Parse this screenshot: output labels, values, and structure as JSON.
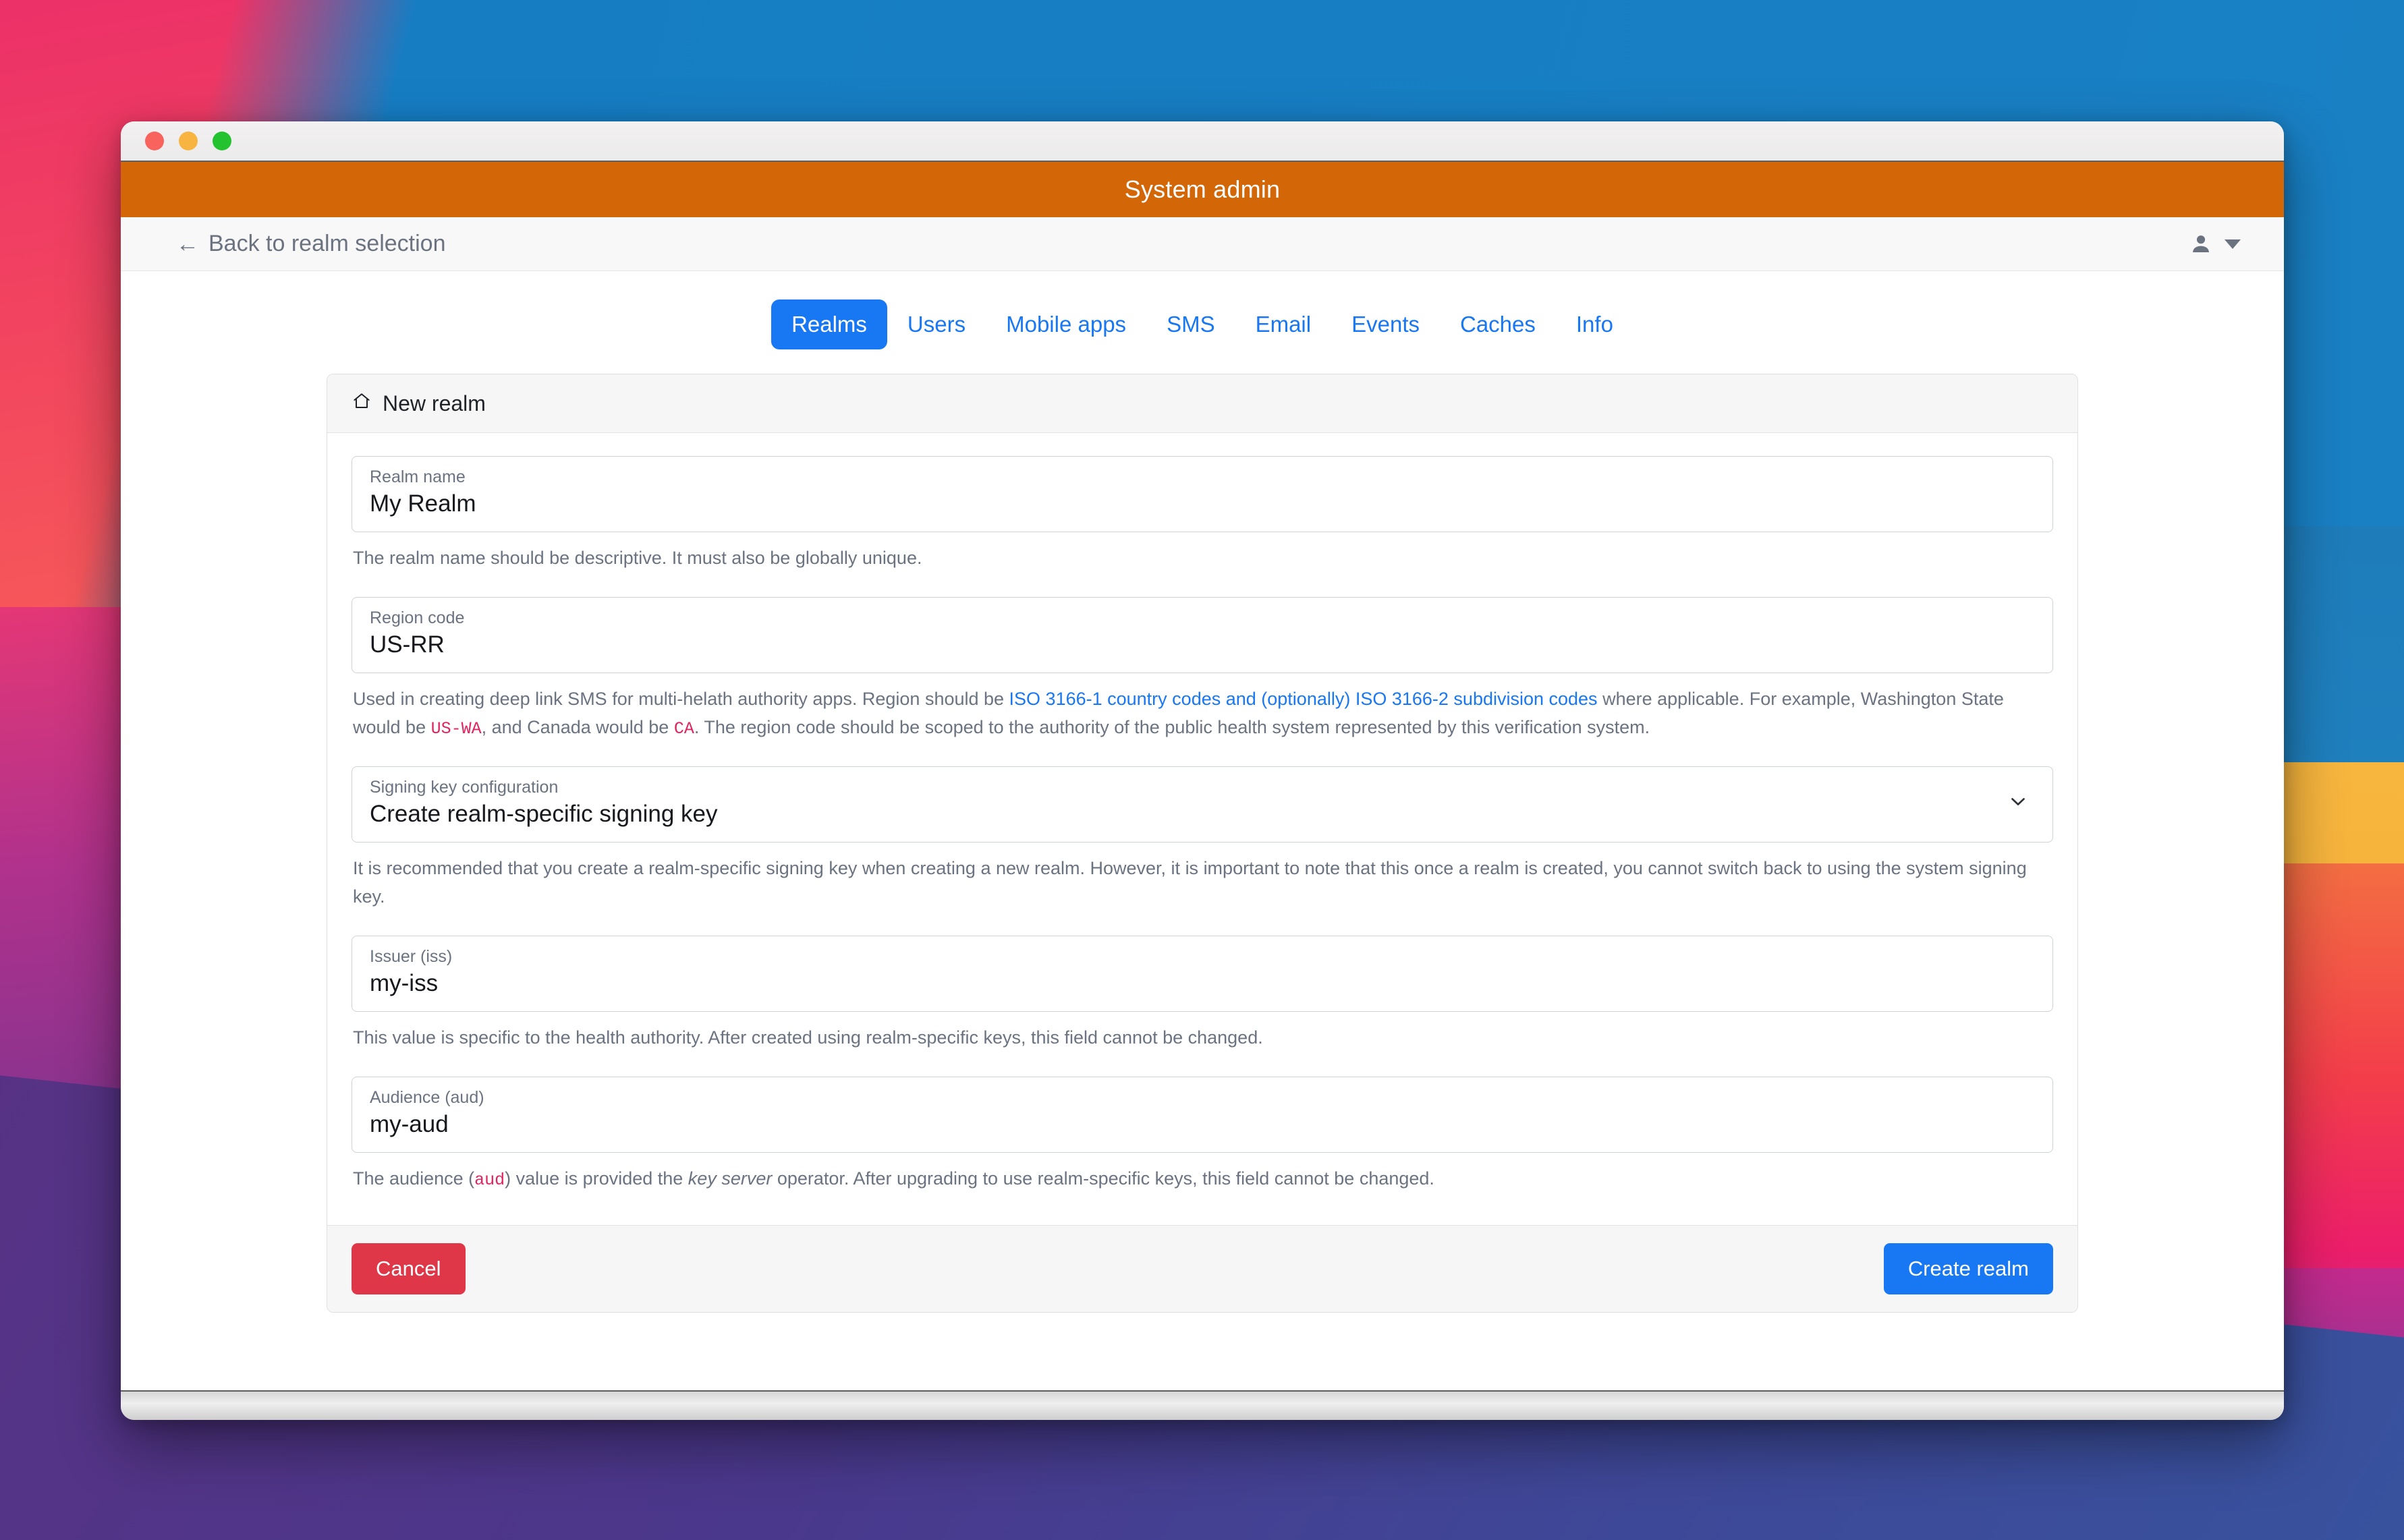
{
  "window": {
    "traffic_lights": [
      "close",
      "minimize",
      "zoom"
    ],
    "brand_title": "System admin",
    "brand_color": "#d36707"
  },
  "navbar": {
    "back_label": "Back to realm selection",
    "back_arrow": "←",
    "user_icon": "person-icon",
    "caret_icon": "chevron-down-icon"
  },
  "tabs": [
    {
      "label": "Realms",
      "active": true
    },
    {
      "label": "Users",
      "active": false
    },
    {
      "label": "Mobile apps",
      "active": false
    },
    {
      "label": "SMS",
      "active": false
    },
    {
      "label": "Email",
      "active": false
    },
    {
      "label": "Events",
      "active": false
    },
    {
      "label": "Caches",
      "active": false
    },
    {
      "label": "Info",
      "active": false
    }
  ],
  "card": {
    "header_icon": "home-icon",
    "header_title": "New realm"
  },
  "form": {
    "realm_name": {
      "label": "Realm name",
      "value": "My Realm",
      "help": "The realm name should be descriptive. It must also be globally unique."
    },
    "region_code": {
      "label": "Region code",
      "value": "US-RR",
      "help_part1": "Used in creating deep link SMS for multi-helath authority apps. Region should be ",
      "help_link": "ISO 3166-1 country codes and (optionally) ISO 3166-2 subdivision codes",
      "help_part2": " where applicable. For example, Washington State would be ",
      "help_code1": "US-WA",
      "help_part3": ", and Canada would be ",
      "help_code2": "CA",
      "help_part4": ". The region code should be scoped to the authority of the public health system represented by this verification system."
    },
    "signing_key": {
      "label": "Signing key configuration",
      "value": "Create realm-specific signing key",
      "help": "It is recommended that you create a realm-specific signing key when creating a new realm. However, it is important to note that this once a realm is created, you cannot switch back to using the system signing key.",
      "chevron_icon": "chevron-down-icon"
    },
    "issuer": {
      "label": "Issuer (iss)",
      "value": "my-iss",
      "help": "This value is specific to the health authority. After created using realm-specific keys, this field cannot be changed."
    },
    "audience": {
      "label": "Audience (aud)",
      "value": "my-aud",
      "help_part1": "The audience (",
      "help_code": "aud",
      "help_part2": ") value is provided the ",
      "help_em": "key server",
      "help_part3": " operator. After upgrading to use realm-specific keys, this field cannot be changed."
    }
  },
  "footer": {
    "cancel_label": "Cancel",
    "create_label": "Create realm",
    "cancel_color": "#e03748",
    "create_color": "#1877f2"
  }
}
